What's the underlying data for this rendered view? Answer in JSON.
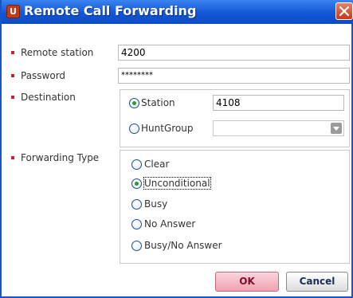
{
  "window": {
    "title": "Remote Call Forwarding",
    "app_icon_glyph": "U"
  },
  "fields": {
    "remote_station_label": "Remote station",
    "remote_station_value": "4200",
    "password_label": "Password",
    "password_value": "********",
    "destination_label": "Destination",
    "forwarding_type_label": "Forwarding Type"
  },
  "destination": {
    "station_label": "Station",
    "station_value": "4108",
    "huntgroup_label": "HuntGroup",
    "huntgroup_value": "",
    "selected": "Station"
  },
  "forwarding_type": {
    "options": [
      "Clear",
      "Unconditional",
      "Busy",
      "No Answer",
      "Busy/No Answer"
    ],
    "selected": "Unconditional"
  },
  "buttons": {
    "ok": "OK",
    "cancel": "Cancel"
  },
  "colors": {
    "title_bar": "#1357d6",
    "bullet": "#c8202a",
    "ok_button": "#f1a2b1",
    "selected_radio_dot": "#2a9a2a"
  }
}
